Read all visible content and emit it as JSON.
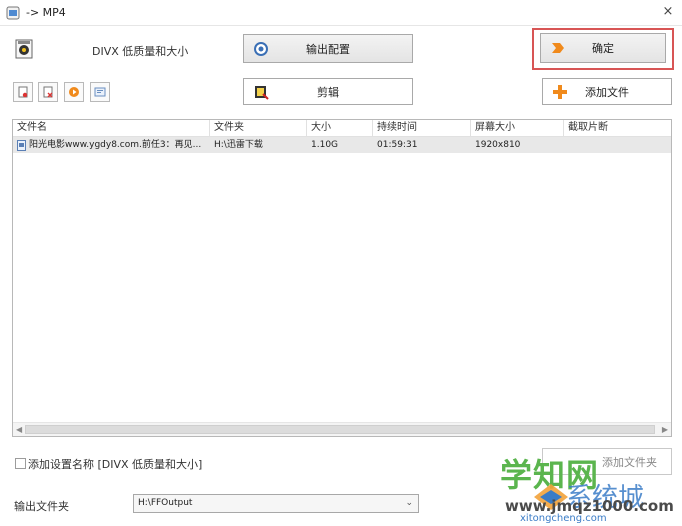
{
  "window": {
    "title": "-> MP4",
    "close_glyph": "×"
  },
  "profile": {
    "text": "DIVX 低质量和大小"
  },
  "buttons": {
    "output_config": "输出配置",
    "ok": "确定",
    "clip": "剪辑",
    "add_file": "添加文件",
    "add_folder": "添加文件夹"
  },
  "toolbar_icons": [
    "remove-file-icon",
    "clear-list-icon",
    "play-icon",
    "media-info-icon"
  ],
  "table": {
    "columns": [
      "文件名",
      "文件夹",
      "大小",
      "持续时间",
      "屏幕大小",
      "截取片断"
    ],
    "rows": [
      {
        "filename": "阳光电影www.ygdy8.com.前任3：再见...",
        "folder": "H:\\迅雷下载",
        "size": "1.10G",
        "duration": "01:59:31",
        "screen": "1920x810",
        "clip": ""
      }
    ]
  },
  "options": {
    "add_setting_name_label": "添加设置名称 [DIVX 低质量和大小]",
    "add_setting_name_checked": false
  },
  "output": {
    "label": "输出文件夹",
    "path": "H:\\FFOutput"
  },
  "watermark": {
    "line1": "学知网",
    "line2": "系统城",
    "line3": "www.jmqz1000.com",
    "line4": "xitongcheng.com"
  },
  "colors": {
    "highlight_border": "#d85555",
    "row_selected": "#e8e8e8",
    "watermark_green": "#5bb54e",
    "watermark_blue": "#3a7cc7"
  }
}
